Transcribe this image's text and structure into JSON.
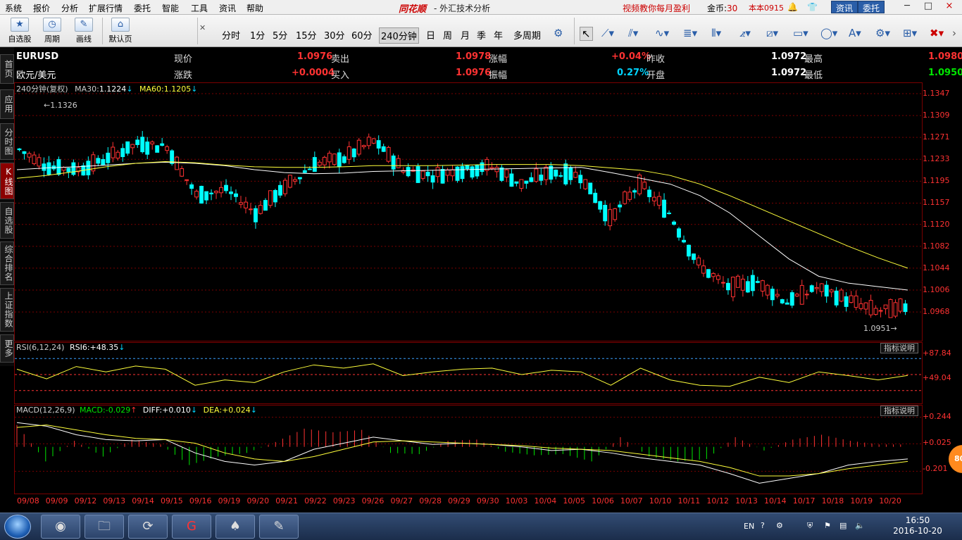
{
  "menu": {
    "items": [
      "系统",
      "报价",
      "分析",
      "扩展行情",
      "委托",
      "智能",
      "工具",
      "资讯",
      "帮助"
    ],
    "brand": "同花顺",
    "title": "- 外汇技术分析",
    "promo": "视频教你每月盈利",
    "coins_label": "金币:",
    "coins_value": "30",
    "version": "本本0915",
    "btn_news": "资讯",
    "btn_trade": "委托",
    "win_min": "─",
    "win_max": "□",
    "win_close": "×"
  },
  "toolbar": {
    "big_buttons": [
      "自选股",
      "周期",
      "画线",
      "默认页"
    ],
    "periods": [
      "分时",
      "1分",
      "5分",
      "15分",
      "30分",
      "60分",
      "240分钟",
      "日",
      "周",
      "月",
      "季",
      "年",
      "多周期"
    ],
    "active_period": "240分钟"
  },
  "sidebar": {
    "items": [
      "首页",
      "应用",
      "分时图",
      "K线图",
      "自选股",
      "综合排名",
      "上证指数",
      "更多"
    ],
    "active": "K线图"
  },
  "quote": {
    "symbol": "EURUSD",
    "name": "欧元/美元",
    "row1": [
      {
        "label": "现价",
        "value": "1.0976"
      },
      {
        "label": "卖出",
        "value": "1.0978"
      },
      {
        "label": "涨幅",
        "value": "+0.04%"
      },
      {
        "label": "昨收",
        "value": "1.0972"
      },
      {
        "label": "最高",
        "value": "1.0980"
      }
    ],
    "row2": [
      {
        "label": "涨跌",
        "value": "+0.0004"
      },
      {
        "label": "买入",
        "value": "1.0976"
      },
      {
        "label": "振幅",
        "value": "0.27%"
      },
      {
        "label": "开盘",
        "value": "1.0972"
      },
      {
        "label": "最低",
        "value": "1.0950"
      }
    ]
  },
  "colors": {
    "up": "#ff3232",
    "down": "#00ffff",
    "ma30": "#ffffff",
    "ma60": "#ffff3b",
    "grid": "#7a0000",
    "axis": "#ff3232"
  },
  "main_panel": {
    "title": "240分钟(复权)",
    "ma30_label": "MA30:",
    "ma30_value": "1.1224",
    "ma60_label": "MA60:",
    "ma60_value": "1.1205",
    "high_mark": "1.1326",
    "low_mark": "1.0951",
    "yticks": [
      "1.1347",
      "1.1309",
      "1.1271",
      "1.1233",
      "1.1195",
      "1.1157",
      "1.1120",
      "1.1082",
      "1.1044",
      "1.1006",
      "1.0968"
    ]
  },
  "rsi_panel": {
    "title": "RSI(6,12,24)",
    "rsi6_label": "RSI6:",
    "rsi6_value": "+48.35",
    "button": "指标说明",
    "yticks": [
      "+87.84",
      "+49.04"
    ]
  },
  "macd_panel": {
    "title": "MACD(12,26,9)",
    "macd_label": "MACD:",
    "macd_value": "-0.029",
    "diff_label": "DIFF:",
    "diff_value": "+0.010",
    "dea_label": "DEA:",
    "dea_value": "+0.024",
    "button": "指标说明",
    "yticks": [
      "+0.244",
      "+0.025",
      "-0.201"
    ]
  },
  "xaxis": {
    "dates": [
      "09/08",
      "09/09",
      "09/12",
      "09/13",
      "09/14",
      "09/15",
      "09/16",
      "09/19",
      "09/20",
      "09/21",
      "09/22",
      "09/23",
      "09/26",
      "09/27",
      "09/28",
      "09/29",
      "09/30",
      "10/03",
      "10/04",
      "10/05",
      "10/06",
      "10/07",
      "10/10",
      "10/11",
      "10/12",
      "10/13",
      "10/14",
      "10/17",
      "10/18",
      "10/19",
      "10/20"
    ]
  },
  "chart_data": {
    "type": "candlestick",
    "title": "240分钟(复权)",
    "ylim": [
      1.0951,
      1.1347
    ],
    "x": [
      "09/08",
      "09/09",
      "09/12",
      "09/13",
      "09/14",
      "09/15",
      "09/16",
      "09/19",
      "09/20",
      "09/21",
      "09/22",
      "09/23",
      "09/26",
      "09/27",
      "09/28",
      "09/29",
      "09/30",
      "10/03",
      "10/04",
      "10/05",
      "10/06",
      "10/07",
      "10/10",
      "10/11",
      "10/12",
      "10/13",
      "10/14",
      "10/17",
      "10/18",
      "10/19",
      "10/20"
    ],
    "close": [
      1.125,
      1.122,
      1.1215,
      1.1235,
      1.126,
      1.1255,
      1.117,
      1.118,
      1.114,
      1.1185,
      1.1225,
      1.1235,
      1.1265,
      1.1215,
      1.1205,
      1.1215,
      1.122,
      1.119,
      1.121,
      1.1205,
      1.113,
      1.119,
      1.114,
      1.105,
      1.101,
      1.102,
      1.0985,
      1.101,
      1.099,
      1.097,
      1.0976
    ],
    "ma30": [
      1.1215,
      1.1218,
      1.122,
      1.1223,
      1.1226,
      1.1228,
      1.1226,
      1.1222,
      1.1215,
      1.121,
      1.1208,
      1.1209,
      1.1212,
      1.1213,
      1.1214,
      1.1215,
      1.1216,
      1.1217,
      1.1218,
      1.1219,
      1.121,
      1.12,
      1.119,
      1.117,
      1.114,
      1.11,
      1.106,
      1.103,
      1.1018,
      1.1012,
      1.1006
    ],
    "ma60": [
      1.12,
      1.1205,
      1.1212,
      1.122,
      1.1226,
      1.1229,
      1.1227,
      1.1223,
      1.122,
      1.1219,
      1.1219,
      1.122,
      1.1222,
      1.1222,
      1.1222,
      1.1223,
      1.1224,
      1.1224,
      1.1224,
      1.1222,
      1.1218,
      1.1214,
      1.1205,
      1.119,
      1.117,
      1.1148,
      1.1126,
      1.1104,
      1.1082,
      1.1062,
      1.1044
    ],
    "rsi6": [
      60,
      42,
      65,
      55,
      66,
      60,
      30,
      40,
      35,
      55,
      68,
      62,
      70,
      48,
      55,
      60,
      62,
      50,
      58,
      55,
      30,
      62,
      40,
      30,
      28,
      45,
      35,
      55,
      48,
      40,
      48.35
    ],
    "macd": [
      0.18,
      -0.12,
      0.05,
      -0.08,
      0.06,
      0.02,
      -0.15,
      -0.08,
      -0.05,
      0.04,
      0.15,
      0.12,
      0.14,
      -0.05,
      -0.06,
      0.05,
      0.06,
      -0.04,
      -0.07,
      -0.06,
      -0.12,
      0.08,
      -0.08,
      -0.12,
      -0.1,
      0.08,
      -0.03,
      0.06,
      0.1,
      0.05,
      0.02
    ],
    "diff": [
      0.2,
      0.17,
      0.1,
      0.06,
      0.05,
      0.06,
      -0.05,
      -0.12,
      -0.15,
      -0.12,
      -0.02,
      0.03,
      0.08,
      0.05,
      0.02,
      0.03,
      0.02,
      0.0,
      -0.03,
      -0.02,
      -0.05,
      -0.09,
      -0.12,
      -0.15,
      -0.22,
      -0.3,
      -0.26,
      -0.22,
      -0.15,
      -0.12,
      -0.1
    ],
    "dea": [
      0.16,
      0.18,
      0.14,
      0.1,
      0.07,
      0.06,
      0.03,
      -0.05,
      -0.1,
      -0.12,
      -0.08,
      -0.02,
      0.04,
      0.05,
      0.04,
      0.03,
      0.02,
      0.01,
      -0.01,
      -0.02,
      -0.03,
      -0.06,
      -0.09,
      -0.12,
      -0.17,
      -0.24,
      -0.24,
      -0.22,
      -0.18,
      -0.15,
      -0.12
    ]
  },
  "tray": {
    "lang": "EN",
    "time": "16:50",
    "date": "2016-10-20",
    "badge": "80"
  }
}
